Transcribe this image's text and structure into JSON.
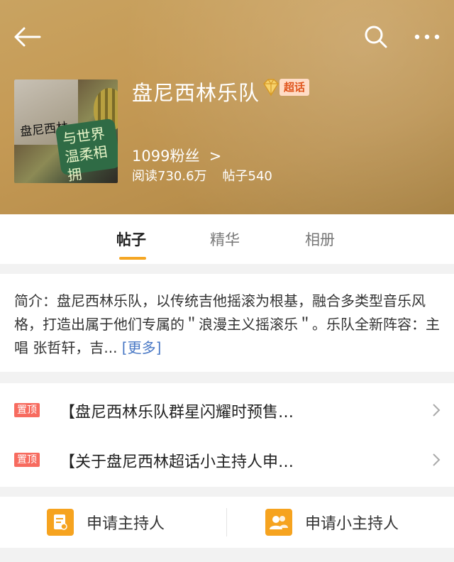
{
  "header": {
    "group_name": "盘尼西林乐队",
    "badge_label": "超话",
    "fans": "1099粉丝  >",
    "reads": "阅读730.6万",
    "posts": "帖子540",
    "cover_text_sticker": "与世界\n温柔相拥",
    "cover_text_handwritten": "盘尼西林",
    "icons": {
      "back": "back-arrow-icon",
      "search": "search-icon",
      "more": "more-dots-icon",
      "badge": "diamond-icon"
    }
  },
  "tabs": [
    {
      "label": "帖子",
      "active": true
    },
    {
      "label": "精华",
      "active": false
    },
    {
      "label": "相册",
      "active": false
    }
  ],
  "intro": {
    "text": "简介：盘尼西林乐队，以传统吉他摇滚为根基，融合多类型音乐风格，打造出属于他们专属的＂浪漫主义摇滚乐＂。乐队全新阵容：主唱 张哲轩，吉...",
    "more": "[更多]"
  },
  "pinned": [
    {
      "tag": "置顶",
      "title": "【盘尼西林乐队群星闪耀时预售…"
    },
    {
      "tag": "置顶",
      "title": "【关于盘尼西林超话小主持人申…"
    }
  ],
  "actions": [
    {
      "label": "申请主持人",
      "icon": "apply-host-icon"
    },
    {
      "label": "申请小主持人",
      "icon": "apply-assistant-host-icon"
    }
  ],
  "colors": {
    "accent": "#f5a623",
    "pin_tag": "#f76b5f",
    "link": "#4978c5",
    "header": "#c59a55"
  }
}
